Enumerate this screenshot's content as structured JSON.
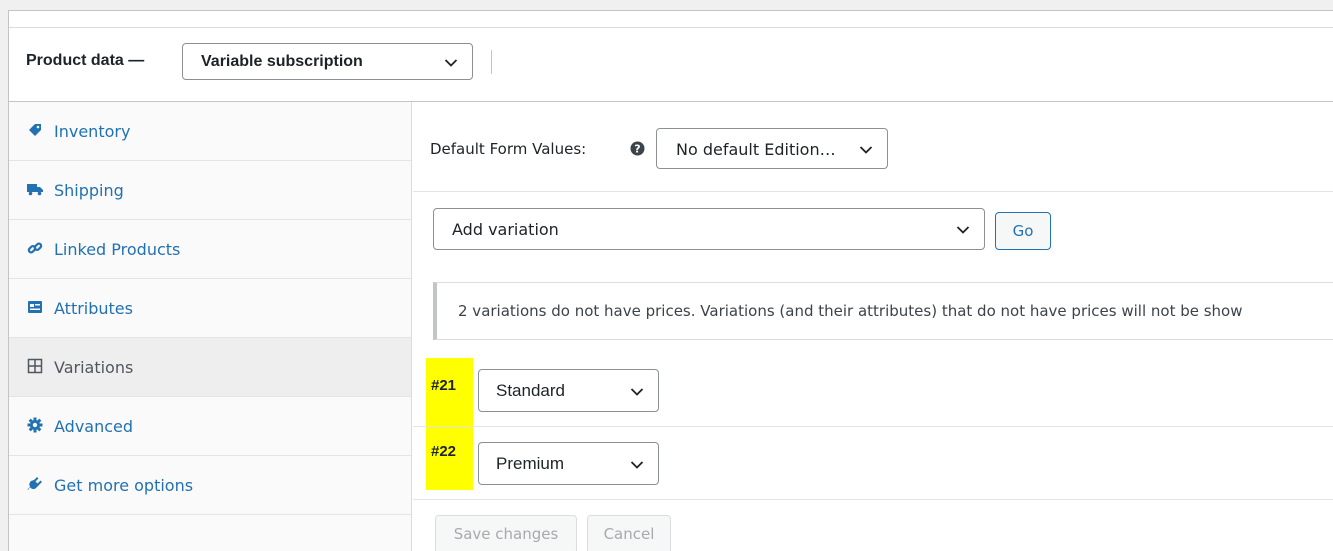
{
  "header": {
    "label": "Product data —",
    "product_type": "Variable subscription"
  },
  "sidebar": {
    "items": [
      {
        "label": "Inventory",
        "icon": "tag-icon",
        "active": false
      },
      {
        "label": "Shipping",
        "icon": "truck-icon",
        "active": false
      },
      {
        "label": "Linked Products",
        "icon": "link-icon",
        "active": false
      },
      {
        "label": "Attributes",
        "icon": "attributes-card-icon",
        "active": false
      },
      {
        "label": "Variations",
        "icon": "grid-icon",
        "active": true
      },
      {
        "label": "Advanced",
        "icon": "gear-icon",
        "active": false
      },
      {
        "label": "Get more options",
        "icon": "plugin-plug-icon",
        "active": false
      }
    ]
  },
  "main": {
    "default_form_values_label": "Default Form Values:",
    "default_edition_value": "No default Edition…",
    "add_variation_value": "Add variation",
    "go_label": "Go",
    "notice": "2 variations do not have prices. Variations (and their attributes) that do not have prices will not be show",
    "variations": [
      {
        "id": "#21",
        "value": "Standard"
      },
      {
        "id": "#22",
        "value": "Premium"
      }
    ],
    "save_label": "Save changes",
    "cancel_label": "Cancel"
  },
  "colors": {
    "link": "#2271b1",
    "highlight": "#ffff00",
    "active_bg": "#eeeeee"
  }
}
